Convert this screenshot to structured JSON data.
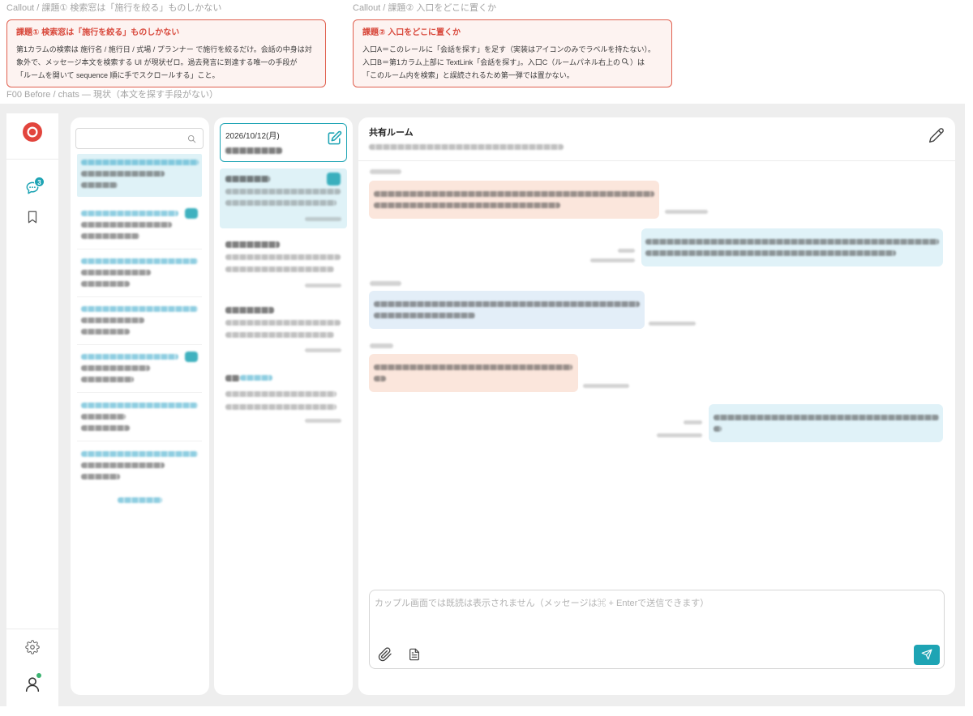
{
  "callout_labels": [
    "Callout / 課題① 検索窓は「施行を絞る」ものしかない",
    "Callout / 課題② 入口をどこに置くか"
  ],
  "callouts": [
    {
      "title": "課題① 検索窓は「施行を絞る」ものしかない",
      "lines": [
        "第1カラムの検索は 施行名 / 施行日 / 式場 / プランナー で施行を絞るだけ。会話の中身は対",
        "象外で、メッセージ本文を検索する UI が現状ゼロ。過去発言に到達する唯一の手段が",
        "「ルームを開いて sequence 順に手でスクロールする」こと。"
      ]
    },
    {
      "title": "課題② 入口をどこに置くか",
      "lines": [
        "入口A＝このレールに「会話を探す」を足す（実装はアイコンのみでラベルを持たない）。",
        {
          "before": "入口B＝第1カラム上部に TextLink「会話を探す」。入口C（ルームパネル右上の",
          "icon": "search-icon",
          "after": "）は"
        },
        "「このルーム内を検索」と誤読されるため第一弾では置かない。"
      ]
    }
  ],
  "frame_label": "F00 Before / chats — 現状（本文を探す手段がない）",
  "rail": {
    "logo_icon": "brand-logo-icon",
    "chat_icon": "chat-bubble-icon",
    "chat_unread_badge": "3",
    "bookmark_icon": "bookmark-icon",
    "settings_icon": "gear-icon",
    "account_icon": "user-icon"
  },
  "wedding_list": {
    "search_icon": "search-icon"
  },
  "room_list": {
    "date": "2026/10/12(月)",
    "compose_icon": "edit-square-icon"
  },
  "room": {
    "title": "共有ルーム",
    "edit_icon": "pencil-icon"
  },
  "composer": {
    "placeholder": "カップル画面では既読は表示されません（メッセージは⌘ + Enterで送信できます）",
    "attach_icon": "paperclip-icon",
    "template_icon": "document-icon",
    "send_icon": "send-icon"
  },
  "colors": {
    "accent": "#1ea4b4",
    "alert": "#e0604f",
    "alert-title": "#d8473a",
    "alert-bg": "#fdf3f1",
    "selected-bg": "#dff2f7",
    "bubble-couple": "#fbe6dc",
    "bubble-self": "#e0f2f8",
    "bubble-planner": "#e3eef8",
    "online": "#3cb371",
    "frame-bg": "#eeeeee"
  }
}
